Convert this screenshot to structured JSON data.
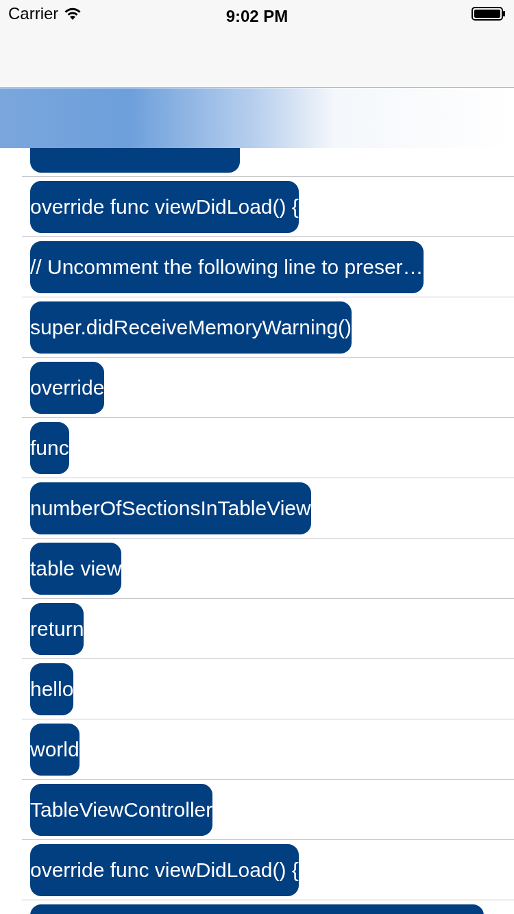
{
  "status_bar": {
    "carrier": "Carrier",
    "time": "9:02 PM"
  },
  "partial_first_row": true,
  "rows": [
    {
      "label": "override func viewDidLoad() {"
    },
    {
      "label": "// Uncomment the following line to preser…"
    },
    {
      "label": "super.didReceiveMemoryWarning()"
    },
    {
      "label": "override"
    },
    {
      "label": "func"
    },
    {
      "label": "numberOfSectionsInTableView"
    },
    {
      "label": "table view"
    },
    {
      "label": "return"
    },
    {
      "label": "hello"
    },
    {
      "label": "world"
    },
    {
      "label": "TableViewController"
    },
    {
      "label": "override func viewDidLoad() {"
    }
  ],
  "partial_last_row": true
}
